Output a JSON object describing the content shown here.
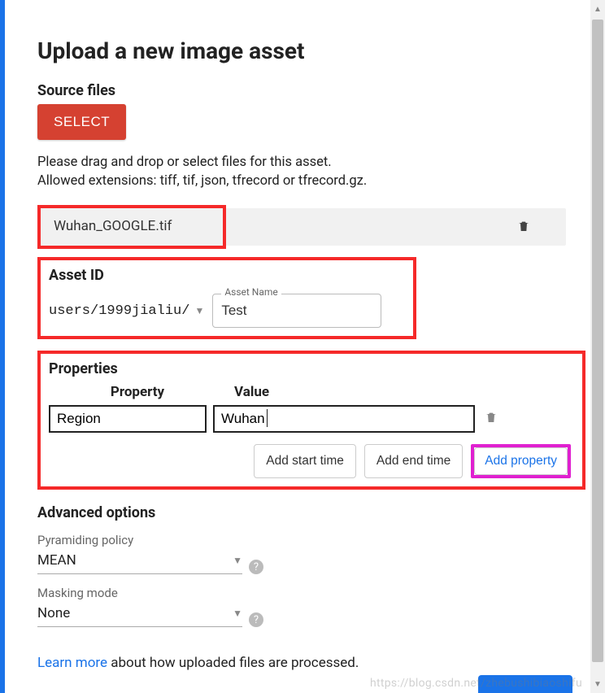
{
  "header": {
    "title": "Upload a new image asset"
  },
  "source": {
    "label": "Source files",
    "select_label": "SELECT",
    "help_line1": "Please drag and drop or select files for this asset.",
    "help_line2": "Allowed extensions: tiff, tif, json, tfrecord or tfrecord.gz.",
    "file_name": "Wuhan_GOOGLE.tif"
  },
  "asset": {
    "section_label": "Asset ID",
    "prefix": "users/1999jialiu/",
    "name_label": "Asset Name",
    "name_value": "Test"
  },
  "properties": {
    "section_label": "Properties",
    "col_property": "Property",
    "col_value": "Value",
    "rows": [
      {
        "key": "Region",
        "value": "Wuhan"
      }
    ],
    "buttons": {
      "add_start": "Add start time",
      "add_end": "Add end time",
      "add_property": "Add property"
    }
  },
  "advanced": {
    "section_label": "Advanced options",
    "pyramiding_label": "Pyramiding policy",
    "pyramiding_value": "MEAN",
    "masking_label": "Masking mode",
    "masking_value": "None"
  },
  "footer": {
    "learn_more": "Learn more",
    "learn_rest": " about how uploaded files are processed."
  },
  "watermark": "https://blog.csdn.net/zhebushibiaoshifu"
}
